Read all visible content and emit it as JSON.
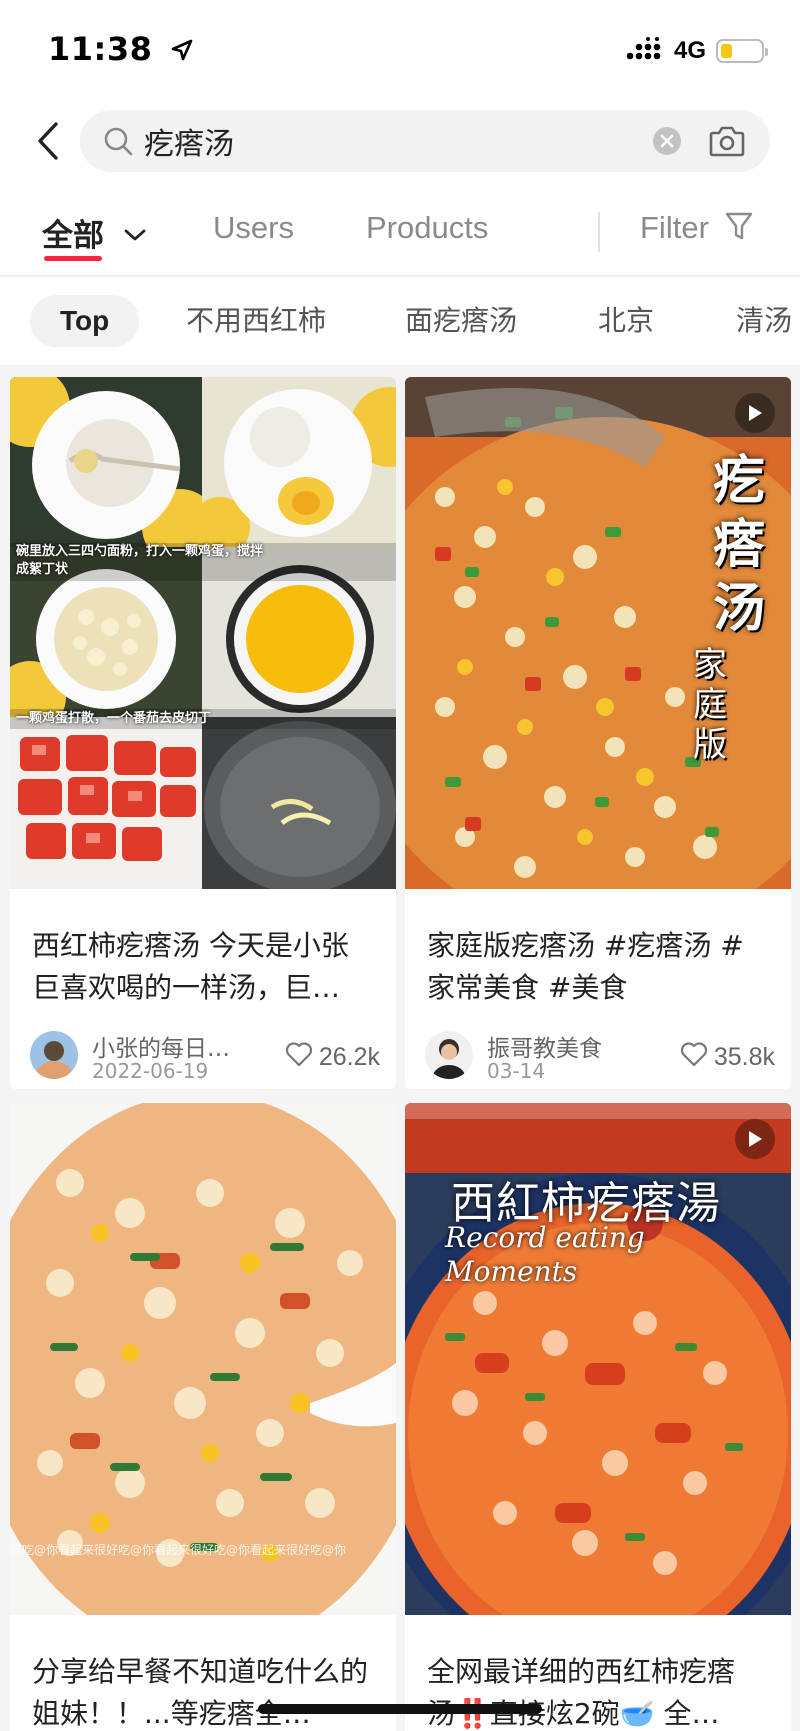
{
  "status_bar": {
    "time": "11:38",
    "network": "4G",
    "battery_level": 0.3,
    "battery_color": "#f5c518"
  },
  "search": {
    "query": "疙瘩汤",
    "icons": [
      "chevron-left-icon",
      "search-icon",
      "clear-icon",
      "camera-icon"
    ]
  },
  "tabs": {
    "all": "全部",
    "users": "Users",
    "products": "Products",
    "filter": "Filter"
  },
  "chips": [
    "Top",
    "不用西红柿",
    "面疙瘩汤",
    "北京",
    "清汤"
  ],
  "accent_color": "#ff2442",
  "posts": [
    {
      "title": "西红柿疙瘩汤 今天是小张巨喜欢喝的一样汤，巨…",
      "author": "小张的每日…",
      "date": "2022-06-19",
      "likes": "26.2k",
      "image_caption_1": "碗里放入三四勺面粉，打入一颗鸡蛋，搅拌成絮丁状",
      "image_caption_2": "一颗鸡蛋打散，一个番茄去皮切丁",
      "is_video": false
    },
    {
      "title": "家庭版疙瘩汤 #疙瘩汤 #家常美食 #美食",
      "author": "振哥教美食",
      "date": "03-14",
      "likes": "35.8k",
      "overlay_title": "疙瘩汤",
      "overlay_subtitle": "家庭版",
      "is_video": true
    },
    {
      "title": "分享给早餐不知道吃什么的姐妹！！...等疙瘩全…",
      "watermark": "好吃@你看起来很好吃@你看起来很好吃@你看起来很好吃@你",
      "is_video": false
    },
    {
      "title": "全网最详细的西红柿疙瘩汤‼️直接炫2碗🥣 全…",
      "overlay_title": "西紅柿疙瘩湯",
      "overlay_subtitle": "Record eating Moments",
      "is_video": true
    }
  ]
}
